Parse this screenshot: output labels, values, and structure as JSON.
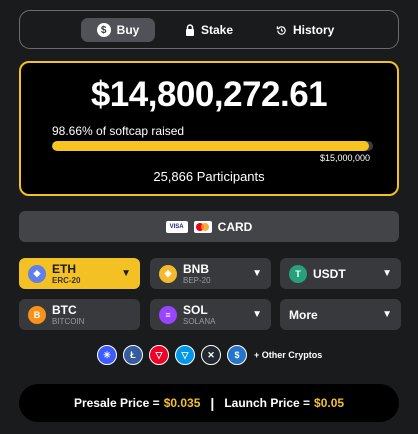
{
  "tabs": [
    {
      "label": "Buy",
      "icon": "dollar-coin-icon",
      "active": true
    },
    {
      "label": "Stake",
      "icon": "lock-icon",
      "active": false
    },
    {
      "label": "History",
      "icon": "history-icon",
      "active": false
    }
  ],
  "raise": {
    "amount": "$14,800,272.61",
    "softcap_text": "98.66% of softcap raised",
    "progress_fraction": 0.9866,
    "goal": "$15,000,000",
    "participants": "25,866 Participants"
  },
  "card_button": {
    "visa": "VISA",
    "label": "CARD"
  },
  "tokens": [
    {
      "symbol": "ETH",
      "network": "ERC-20",
      "selected": true,
      "color": "#627eea",
      "glyph": "◆"
    },
    {
      "symbol": "BNB",
      "network": "BEP-20",
      "selected": false,
      "color": "#f3ba2f",
      "glyph": "◈"
    },
    {
      "symbol": "USDT",
      "network": "",
      "selected": false,
      "color": "#26a17b",
      "glyph": "T"
    },
    {
      "symbol": "BTC",
      "network": "BITCOIN",
      "selected": false,
      "color": "#f7931a",
      "glyph": "B"
    },
    {
      "symbol": "SOL",
      "network": "SOLANA",
      "selected": false,
      "color": "#9945ff",
      "glyph": "≡"
    },
    {
      "symbol": "More",
      "network": "",
      "selected": false
    }
  ],
  "other_cryptos": {
    "icons": [
      "cardano-icon",
      "litecoin-icon",
      "tron-icon",
      "ton-icon",
      "xrp-icon",
      "usdc-icon"
    ],
    "label": "+ Other Cryptos"
  },
  "price_bar": {
    "presale_label": "Presale Price =",
    "presale_value": "$0.035",
    "separator": "|",
    "launch_label": "Launch Price =",
    "launch_value": "$0.05"
  },
  "colors": {
    "accent": "#f3c123",
    "background": "#1a1b1d",
    "button": "#38393d"
  }
}
